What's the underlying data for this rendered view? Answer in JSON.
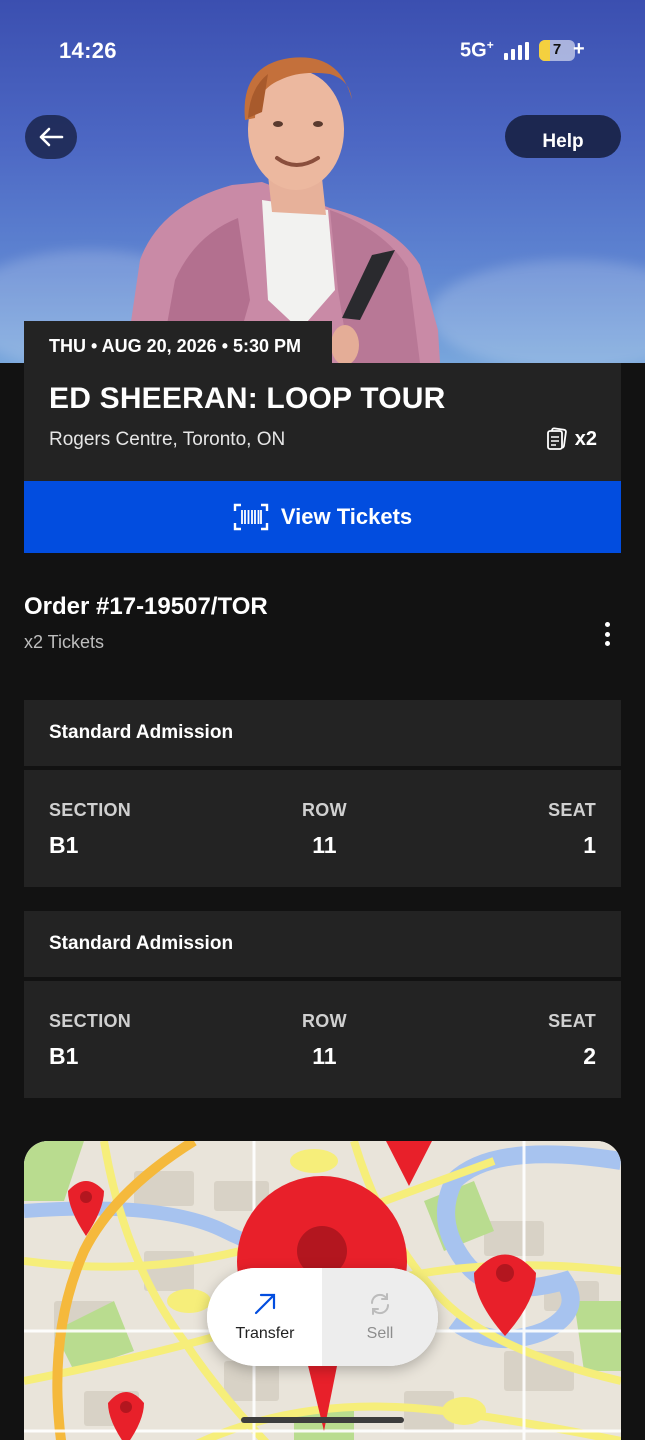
{
  "status_bar": {
    "time": "14:26",
    "network": "5G",
    "network_sup": "+",
    "battery_level": "7",
    "battery_fraction": 0.07,
    "charging_symbol": "+"
  },
  "hero": {
    "back_icon": "arrow-left-icon",
    "help_label": "Help"
  },
  "event": {
    "date_line": "THU • AUG 20, 2026 • 5:30 PM",
    "title": "ED SHEERAN: LOOP TOUR",
    "venue": "Rogers Centre, Toronto, ON",
    "ticket_icon": "ticket-stack-icon",
    "ticket_count": "x2"
  },
  "view_tickets": {
    "icon": "barcode-scan-icon",
    "label": "View Tickets",
    "color": "#024ddf"
  },
  "order": {
    "title": "Order #17-19507/TOR",
    "subtitle": "x2 Tickets",
    "menu_icon": "more-vertical-icon"
  },
  "tickets": [
    {
      "type": "Standard Admission",
      "section_label": "SECTION",
      "section": "B1",
      "row_label": "ROW",
      "row": "11",
      "seat_label": "SEAT",
      "seat": "1"
    },
    {
      "type": "Standard Admission",
      "section_label": "SECTION",
      "section": "B1",
      "row_label": "ROW",
      "row": "11",
      "seat_label": "SEAT",
      "seat": "2"
    }
  ],
  "actions": {
    "transfer_label": "Transfer",
    "transfer_icon": "arrow-up-right-icon",
    "sell_label": "Sell",
    "sell_icon": "refresh-icon",
    "accent": "#024ddf"
  },
  "map": {
    "pin_color": "#e8202a"
  }
}
